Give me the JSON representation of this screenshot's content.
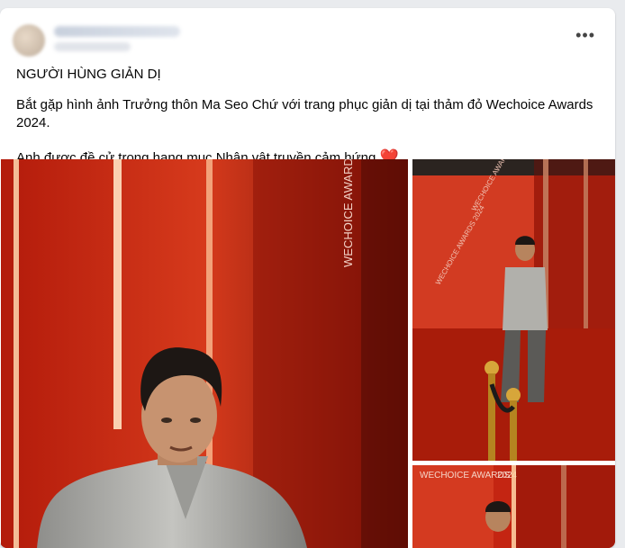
{
  "post": {
    "more_icon": "more-horizontal-icon",
    "title": "NGƯỜI HÙNG GIẢN DỊ",
    "paragraph1": "Bắt gặp hình ảnh Trưởng thôn Ma Seo Chứ với trang phục giản dị tại thảm đỏ Wechoice Awards 2024.",
    "paragraph2": "Anh được đề cử trong hạng mục Nhân vật truyền cảm hứng",
    "heart_icon": "red-heart-icon",
    "heart_glyph": "❤️"
  },
  "photos": {
    "backdrop_text": "WECHOICE AWARDS 2024",
    "backdrop_text_small": "WECHOICE AWARDS",
    "backdrop_year": "2024"
  },
  "colors": {
    "backdrop_red": "#c4230f",
    "shirt_gray": "#a9a9a6",
    "heart": "#e0245e"
  }
}
